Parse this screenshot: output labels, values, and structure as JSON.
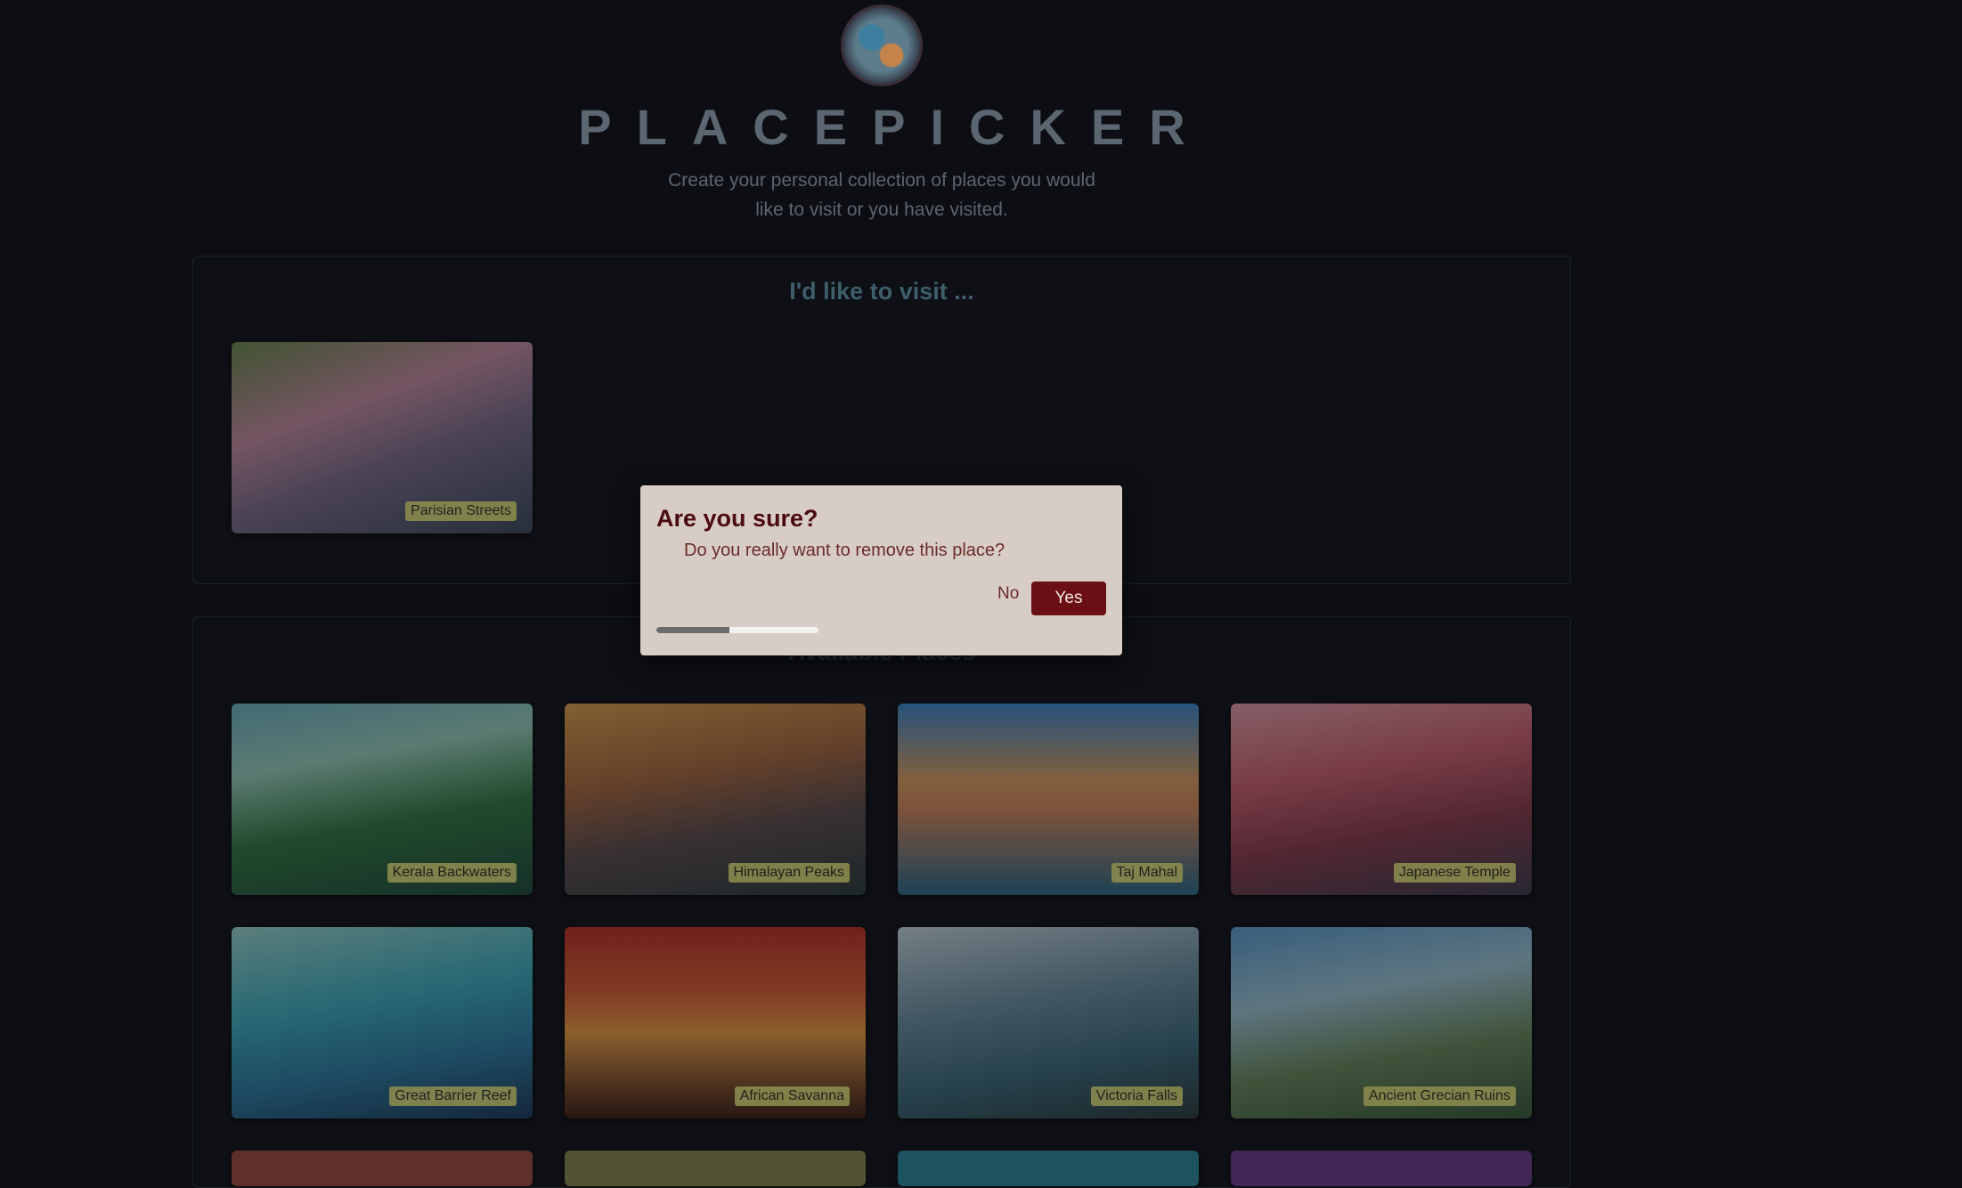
{
  "header": {
    "title": "PLACEPICKER",
    "subtitle": "Create your personal collection of places you would like to visit or you have visited."
  },
  "visit_section": {
    "title": "I'd like to visit ...",
    "places": [
      {
        "label": "Parisian Streets"
      }
    ]
  },
  "available_section": {
    "title": "Available Places",
    "places": [
      {
        "label": "Kerala Backwaters"
      },
      {
        "label": "Himalayan Peaks"
      },
      {
        "label": "Taj Mahal"
      },
      {
        "label": "Japanese Temple"
      },
      {
        "label": "Great Barrier Reef"
      },
      {
        "label": "African Savanna"
      },
      {
        "label": "Victoria Falls"
      },
      {
        "label": "Ancient Grecian Ruins"
      }
    ]
  },
  "modal": {
    "title": "Are you sure?",
    "text": "Do you really want to remove this place?",
    "no_label": "No",
    "yes_label": "Yes",
    "progress_fraction": 0.45
  },
  "colors": {
    "modal_bg": "#d8cdc6",
    "accent": "#6a0f14",
    "label_bg": "#8a8a4e"
  }
}
